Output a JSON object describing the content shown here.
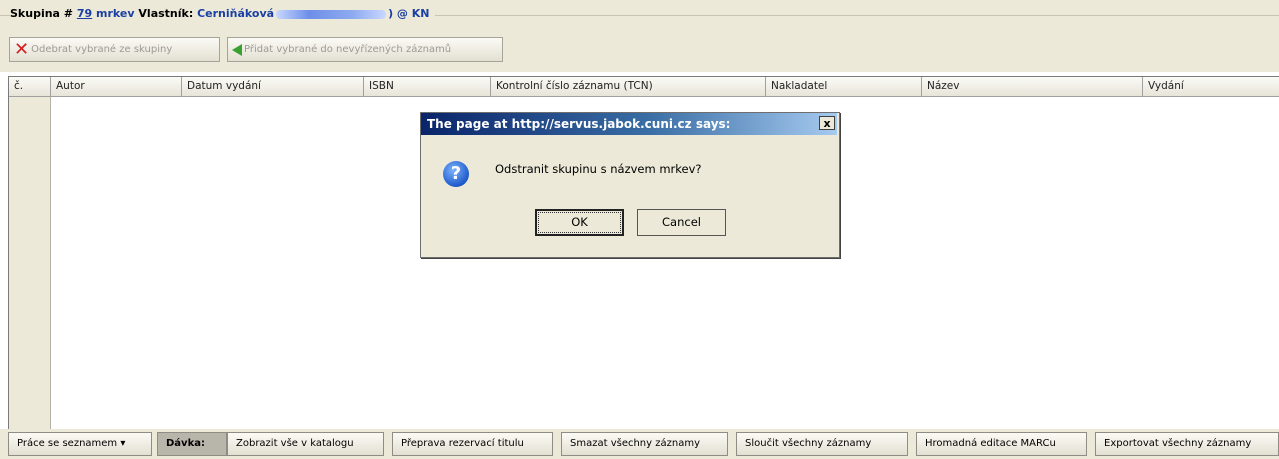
{
  "header": {
    "group_label": "Skupina #",
    "group_number": "79",
    "group_name": "mrkev",
    "owner_label": "Vlastník:",
    "owner_name": "Cerniňáková",
    "owner_suffix": ") @ KN"
  },
  "toolbar": {
    "remove_label": "Odebrat vybrané ze skupiny",
    "add_label": "Přidat vybrané do nevyřízených záznamů"
  },
  "table": {
    "columns": [
      "č.",
      "Autor",
      "Datum vydání",
      "ISBN",
      "Kontrolní číslo záznamu (TCN)",
      "Nakladatel",
      "Název",
      "Vydání"
    ]
  },
  "dialog": {
    "title": "The page at http://servus.jabok.cuni.cz says:",
    "close": "x",
    "message": "Odstranit skupinu s názvem mrkev?",
    "ok": "OK",
    "cancel": "Cancel",
    "icon": "question-icon"
  },
  "bottom": {
    "list_work": "Práce se seznamem ▾",
    "batch_label": "Dávka:",
    "show_all": "Zobrazit vše v katalogu",
    "transfer": "Přeprava rezervací titulu",
    "delete_all": "Smazat všechny záznamy",
    "merge_all": "Sloučit všechny záznamy",
    "marc_edit": "Hromadná editace MARCu",
    "export_all": "Exportovat všechny záznamy"
  }
}
